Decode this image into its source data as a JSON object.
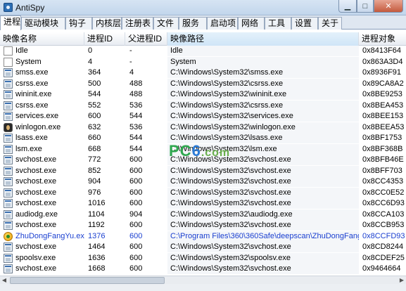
{
  "window": {
    "title": "AntiSpy",
    "min": "▁",
    "max": "□",
    "close": "✕"
  },
  "tabs": [
    "进程",
    "驱动模块",
    "钩子",
    "内核层",
    "注册表",
    "文件",
    "服务",
    "启动项",
    "网络",
    "工具",
    "设置",
    "关于"
  ],
  "table": {
    "columns": [
      "映像名称",
      "进程ID",
      "父进程ID",
      "映像路径",
      "进程对象"
    ],
    "rows": [
      {
        "icon": "blank-doc-icon",
        "name": "Idle",
        "pid": "0",
        "ppid": "-",
        "path": "Idle",
        "obj": "0x8413F64",
        "blue": false
      },
      {
        "icon": "blank-doc-icon",
        "name": "System",
        "pid": "4",
        "ppid": "-",
        "path": "System",
        "obj": "0x863A3D4",
        "blue": false
      },
      {
        "icon": "window-app-icon",
        "name": "smss.exe",
        "pid": "364",
        "ppid": "4",
        "path": "C:\\Windows\\System32\\smss.exe",
        "obj": "0x8936F91",
        "blue": false
      },
      {
        "icon": "window-app-icon",
        "name": "csrss.exe",
        "pid": "500",
        "ppid": "488",
        "path": "C:\\Windows\\System32\\csrss.exe",
        "obj": "0x89CA8A2",
        "blue": false
      },
      {
        "icon": "window-app-icon",
        "name": "wininit.exe",
        "pid": "544",
        "ppid": "488",
        "path": "C:\\Windows\\System32\\wininit.exe",
        "obj": "0x8BE9253",
        "blue": false
      },
      {
        "icon": "window-app-icon",
        "name": "csrss.exe",
        "pid": "552",
        "ppid": "536",
        "path": "C:\\Windows\\System32\\csrss.exe",
        "obj": "0x8BEA453",
        "blue": false
      },
      {
        "icon": "window-app-icon",
        "name": "services.exe",
        "pid": "600",
        "ppid": "544",
        "path": "C:\\Windows\\System32\\services.exe",
        "obj": "0x8BEE153",
        "blue": false
      },
      {
        "icon": "logon-icon",
        "name": "winlogon.exe",
        "pid": "632",
        "ppid": "536",
        "path": "C:\\Windows\\System32\\winlogon.exe",
        "obj": "0x8BEEA53",
        "blue": false
      },
      {
        "icon": "window-app-icon",
        "name": "lsass.exe",
        "pid": "660",
        "ppid": "544",
        "path": "C:\\Windows\\System32\\lsass.exe",
        "obj": "0x8BF1753",
        "blue": false
      },
      {
        "icon": "window-app-icon",
        "name": "lsm.exe",
        "pid": "668",
        "ppid": "544",
        "path": "C:\\Windows\\System32\\lsm.exe",
        "obj": "0x8BF368B",
        "blue": false
      },
      {
        "icon": "window-app-icon",
        "name": "svchost.exe",
        "pid": "772",
        "ppid": "600",
        "path": "C:\\Windows\\System32\\svchost.exe",
        "obj": "0x8BFB46E",
        "blue": false
      },
      {
        "icon": "window-app-icon",
        "name": "svchost.exe",
        "pid": "852",
        "ppid": "600",
        "path": "C:\\Windows\\System32\\svchost.exe",
        "obj": "0x8BFF703",
        "blue": false
      },
      {
        "icon": "window-app-icon",
        "name": "svchost.exe",
        "pid": "904",
        "ppid": "600",
        "path": "C:\\Windows\\System32\\svchost.exe",
        "obj": "0x8CC4353",
        "blue": false
      },
      {
        "icon": "window-app-icon",
        "name": "svchost.exe",
        "pid": "976",
        "ppid": "600",
        "path": "C:\\Windows\\System32\\svchost.exe",
        "obj": "0x8CC0E52",
        "blue": false
      },
      {
        "icon": "window-app-icon",
        "name": "svchost.exe",
        "pid": "1016",
        "ppid": "600",
        "path": "C:\\Windows\\System32\\svchost.exe",
        "obj": "0x8CC6D93",
        "blue": false
      },
      {
        "icon": "window-app-icon",
        "name": "audiodg.exe",
        "pid": "1104",
        "ppid": "904",
        "path": "C:\\Windows\\System32\\audiodg.exe",
        "obj": "0x8CCA103",
        "blue": false
      },
      {
        "icon": "window-app-icon",
        "name": "svchost.exe",
        "pid": "1192",
        "ppid": "600",
        "path": "C:\\Windows\\System32\\svchost.exe",
        "obj": "0x8CCB953",
        "blue": false
      },
      {
        "icon": "zhudong-icon",
        "name": "ZhuDongFangYu.exe",
        "pid": "1376",
        "ppid": "600",
        "path": "C:\\Program Files\\360\\360Safe\\deepscan\\ZhuDongFangY...",
        "obj": "0x8CCFD93",
        "blue": true
      },
      {
        "icon": "window-app-icon",
        "name": "svchost.exe",
        "pid": "1464",
        "ppid": "600",
        "path": "C:\\Windows\\System32\\svchost.exe",
        "obj": "0x8CD8244",
        "blue": false
      },
      {
        "icon": "window-app-icon",
        "name": "spoolsv.exe",
        "pid": "1636",
        "ppid": "600",
        "path": "C:\\Windows\\System32\\spoolsv.exe",
        "obj": "0x8CDEF25",
        "blue": false
      },
      {
        "icon": "window-app-icon",
        "name": "svchost.exe",
        "pid": "1668",
        "ppid": "600",
        "path": "C:\\Windows\\System32\\svchost.exe",
        "obj": "0x9464664",
        "blue": false
      }
    ]
  },
  "watermark": {
    "pc": "PC",
    "six": "6",
    "com": ".com"
  }
}
